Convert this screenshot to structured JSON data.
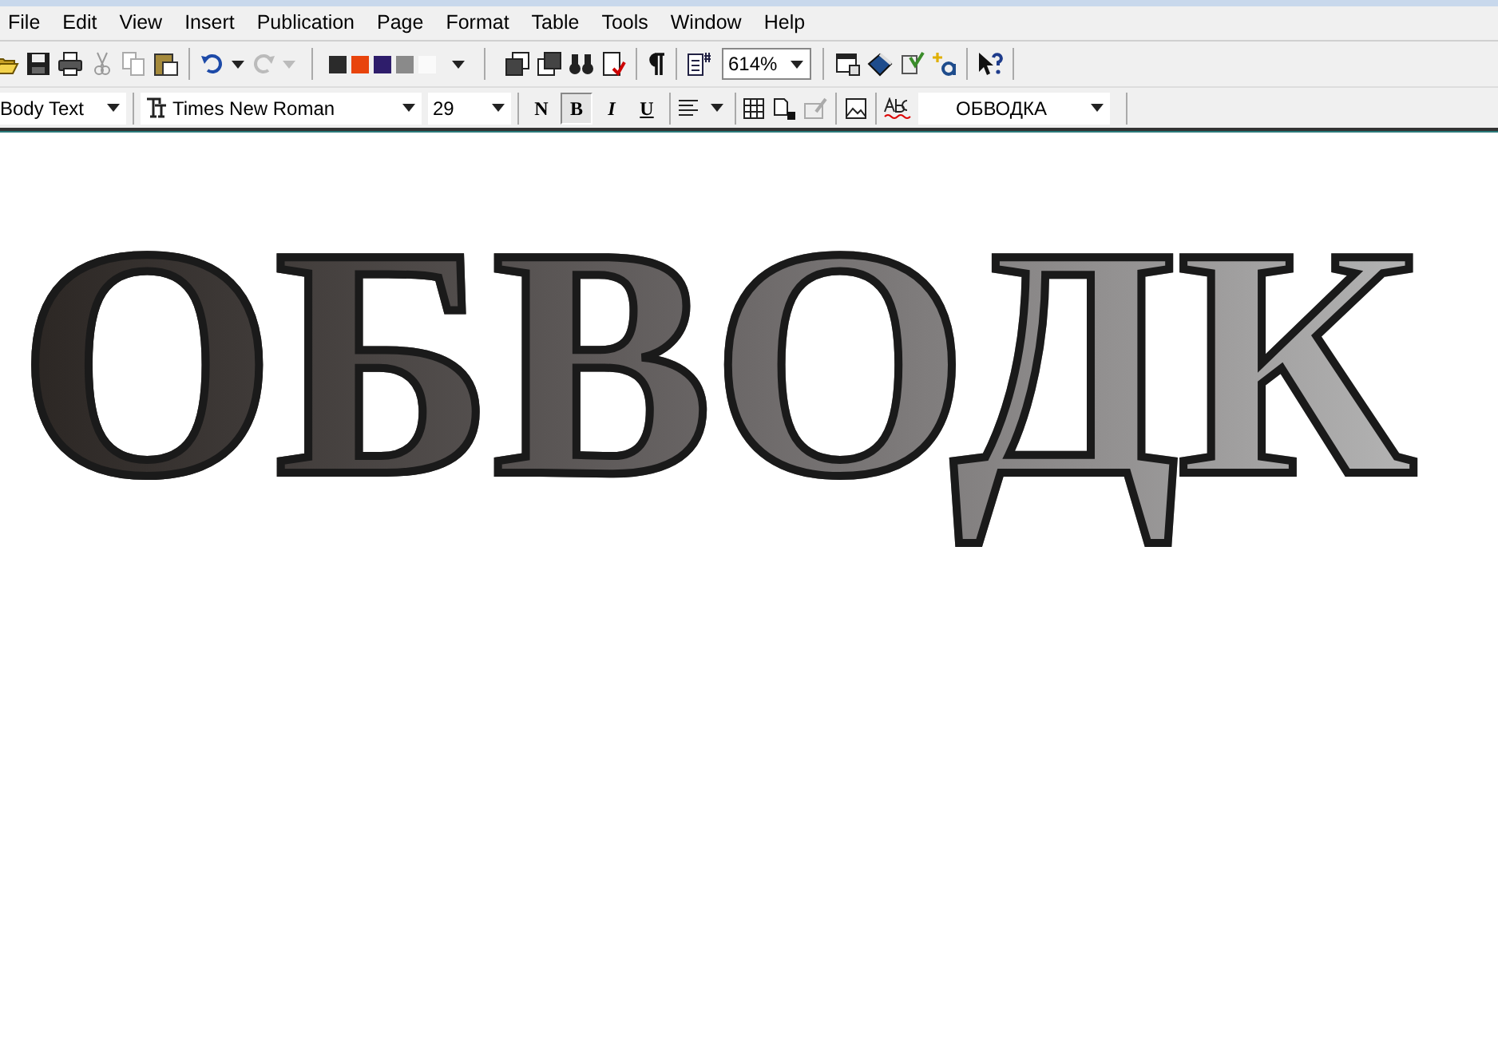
{
  "menu": [
    {
      "label": "File"
    },
    {
      "label": "Edit"
    },
    {
      "label": "View"
    },
    {
      "label": "Insert"
    },
    {
      "label": "Publication"
    },
    {
      "label": "Page"
    },
    {
      "label": "Format"
    },
    {
      "label": "Table"
    },
    {
      "label": "Tools"
    },
    {
      "label": "Window"
    },
    {
      "label": "Help"
    }
  ],
  "swatches": [
    {
      "color": "#2b2b2b"
    },
    {
      "color": "#e8440c"
    },
    {
      "color": "#2e1d6b"
    },
    {
      "color": "#8a8a8a"
    },
    {
      "color": "#fafafa"
    }
  ],
  "zoom": {
    "value": "614%"
  },
  "style_box": {
    "value": "Body Text"
  },
  "font_box": {
    "value": "Times New Roman"
  },
  "size_box": {
    "value": "29"
  },
  "format_buttons": [
    {
      "label": "N",
      "selected": false,
      "kind": "normal"
    },
    {
      "label": "B",
      "selected": true,
      "kind": "bold"
    },
    {
      "label": "I",
      "selected": false,
      "kind": "italic"
    },
    {
      "label": "U",
      "selected": false,
      "kind": "underline"
    }
  ],
  "spell_box": {
    "value": "ОБВОДКА"
  },
  "document": {
    "heading": "ОБВОДК"
  }
}
